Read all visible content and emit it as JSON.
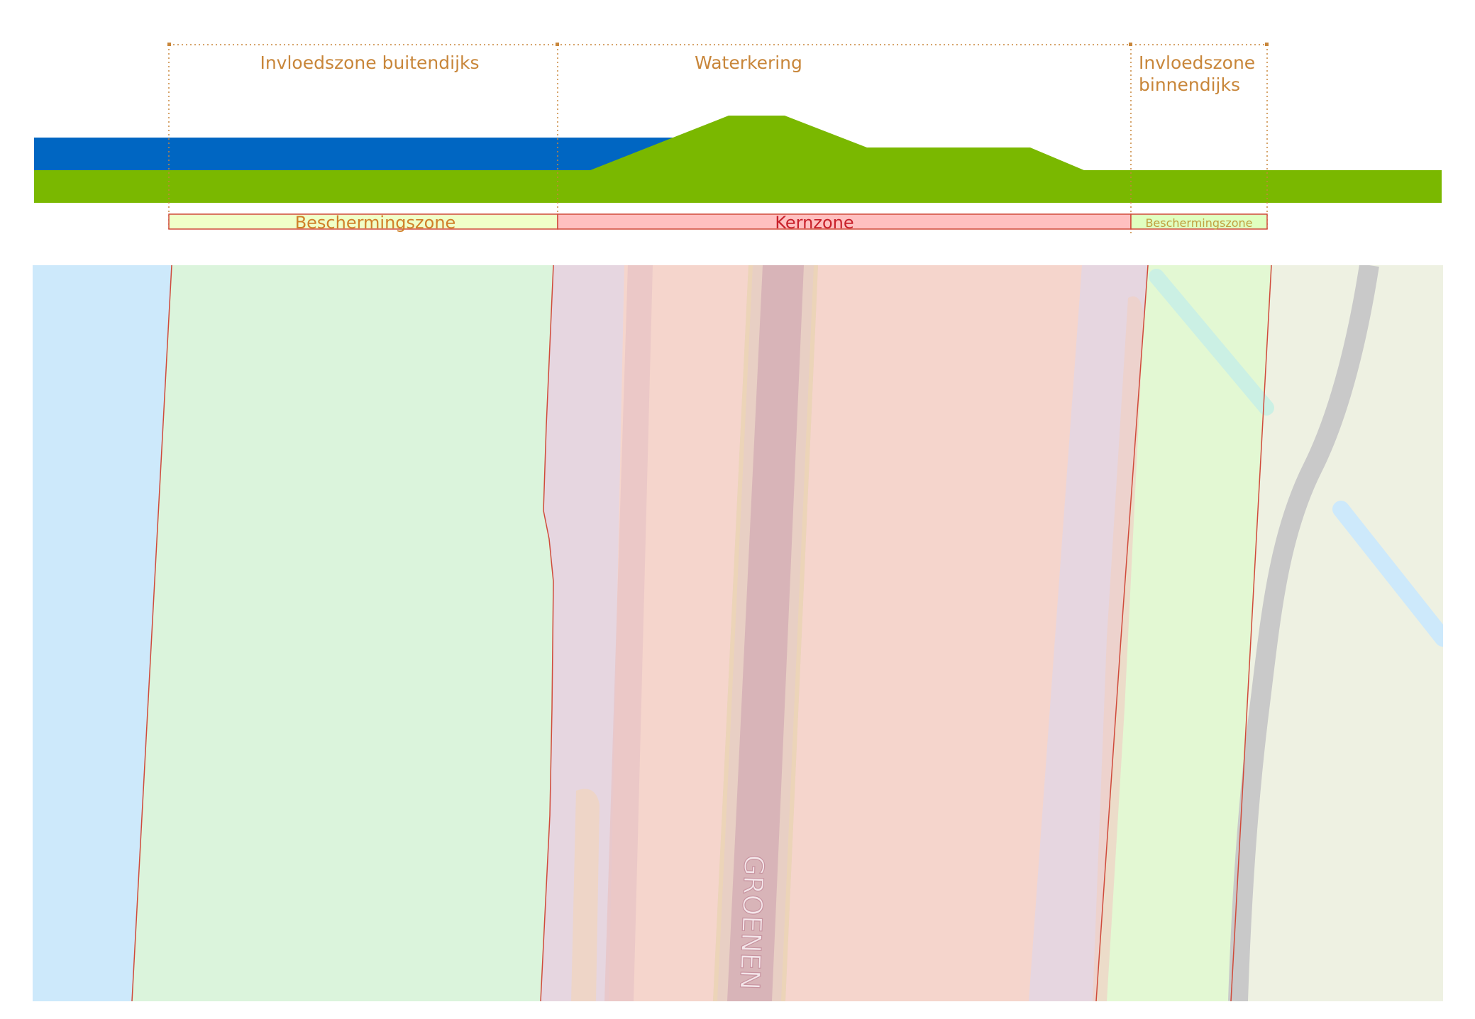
{
  "cross_section": {
    "zones": [
      {
        "label": "Invloedszone buitendijks"
      },
      {
        "label": "Waterkering"
      },
      {
        "label": "Invloedszone",
        "label_line2": "binnendijks"
      }
    ],
    "bars": [
      {
        "label": "Beschermingszone",
        "fill": "#f0ffc8",
        "text_color": "#d08028"
      },
      {
        "label": "Kernzone",
        "fill": "#ffc0c0",
        "text_color": "#c8202a"
      },
      {
        "label": "Beschermingszone",
        "fill": "#e0ffc0",
        "text_color": "#c0a040"
      }
    ],
    "colors": {
      "water": "#0066c2",
      "dike": "#7ab800",
      "dimension_line": "#c8863a",
      "zone_border": "#d04a3a"
    }
  },
  "map": {
    "road_label": "GROENEN",
    "colors": {
      "water": "#cde9fb",
      "protection_outer": "#dbf4dc",
      "core_edge": "#e6d6e0",
      "core": "#f5d5cc",
      "road": "#d8b4b8",
      "protection_inner": "#e3f8d3",
      "hinterland": "#eef1e2",
      "path": "#c9c9c9"
    }
  }
}
